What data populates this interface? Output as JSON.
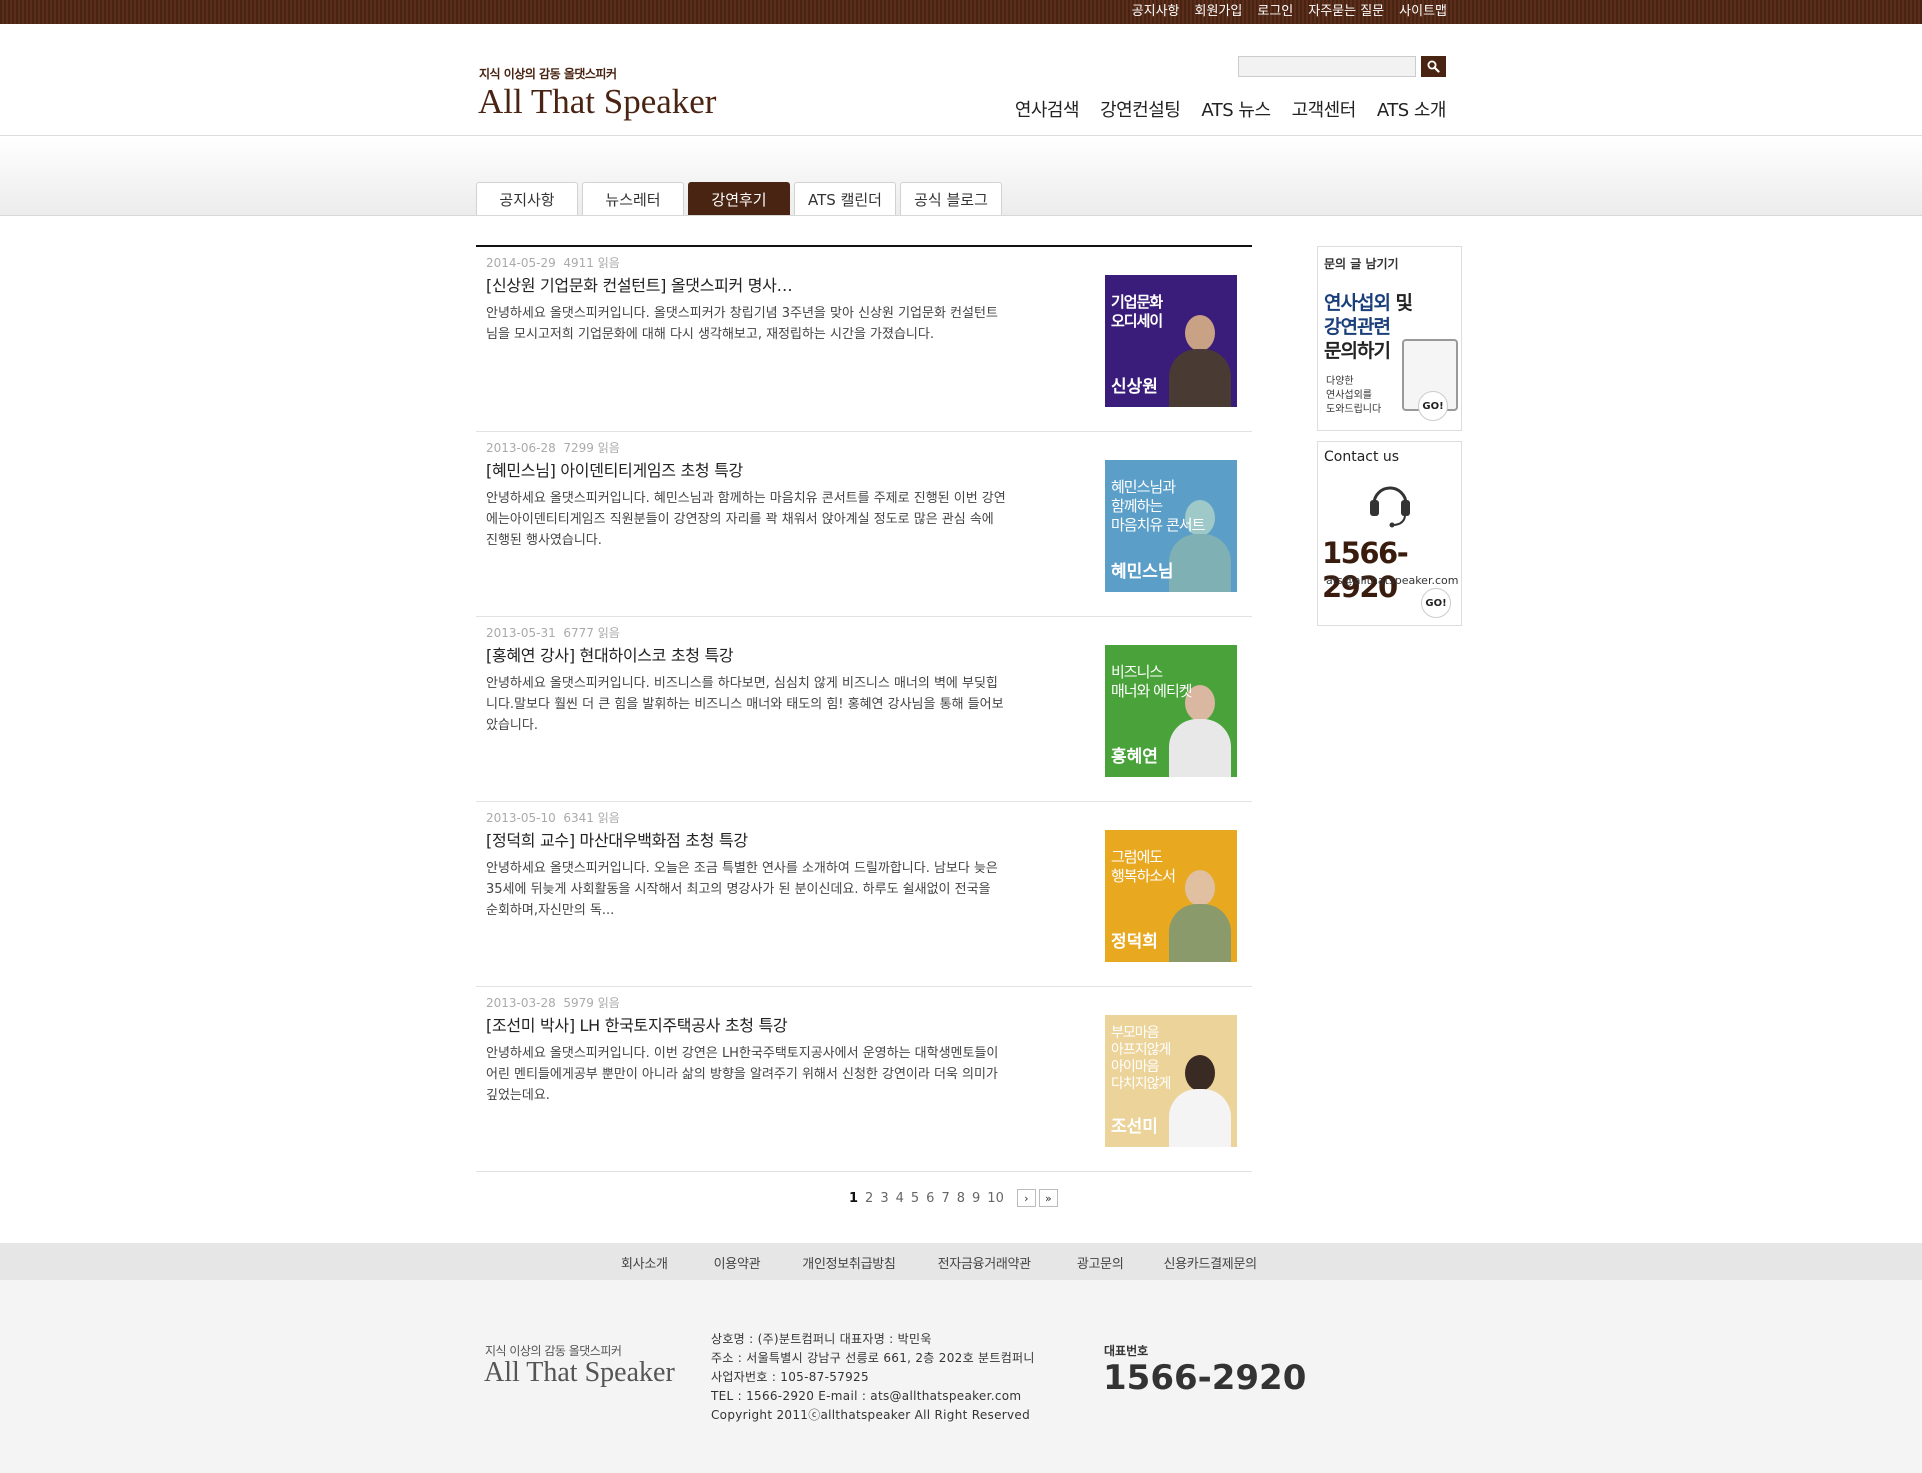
{
  "topbar": {
    "links": [
      "공지사항",
      "회원가입",
      "로그인",
      "자주묻는 질문",
      "사이트맵"
    ]
  },
  "header": {
    "tagline": "지식 이상의 감동 올댓스피커",
    "logo": "All That Speaker",
    "search": {
      "value": "",
      "placeholder": ""
    },
    "nav": [
      "연사검색",
      "강연컨설팅",
      "ATS 뉴스",
      "고객센터",
      "ATS 소개"
    ]
  },
  "tabs": [
    {
      "label": "공지사항",
      "active": false
    },
    {
      "label": "뉴스레터",
      "active": false
    },
    {
      "label": "강연후기",
      "active": true
    },
    {
      "label": "ATS 캘린더",
      "active": false
    },
    {
      "label": "공식 블로그",
      "active": false
    }
  ],
  "posts": [
    {
      "date": "2014-05-29",
      "views": "4911 읽음",
      "title": "[신상원 기업문화 컨설턴트] 올댓스피커 명사…",
      "desc": "안녕하세요 올댓스피커입니다. 올댓스피커가 창립기념 3주년을 맞아 신상원 기업문화 컨설턴트님을 모시고저희 기업문화에 대해 다시 생각해보고, 재정립하는 시간을 가졌습니다.",
      "thumb_caption": "기업문화\n오디세이",
      "thumb_name": "신상원",
      "thumb_color": "#3a1d7a"
    },
    {
      "date": "2013-06-28",
      "views": "7299 읽음",
      "title": "[혜민스님] 아이덴티티게임즈 초청 특강",
      "desc": "안녕하세요 올댓스피커입니다. 혜민스님과 함께하는 마음치유 콘서트를 주제로 진행된 이번 강연에는아이덴티티게임즈 직원분들이 강연장의 자리를 꽉 채워서 앉아계실 정도로 많은 관심 속에 진행된 행사였습니다.",
      "thumb_caption": "혜민스님과\n함께하는\n마음치유 콘서트",
      "thumb_name": "혜민스님",
      "thumb_color": "#5b9fc9"
    },
    {
      "date": "2013-05-31",
      "views": "6777 읽음",
      "title": "[홍혜연 강사] 현대하이스코 초청 특강",
      "desc": "안녕하세요 올댓스피커입니다. 비즈니스를 하다보면, 심심치 않게 비즈니스 매너의 벽에 부딪힙니다.말보다 훨씬 더 큰 힘을 발휘하는 비즈니스 매너와 태도의 힘! 홍혜연 강사님을 통해 들어보았습니다.",
      "thumb_caption": "비즈니스\n매너와 에티켓",
      "thumb_name": "홍혜연",
      "thumb_color": "#4aa33a"
    },
    {
      "date": "2013-05-10",
      "views": "6341 읽음",
      "title": "[정덕희 교수] 마산대우백화점 초청 특강",
      "desc": "안녕하세요 올댓스피커입니다. 오늘은 조금 특별한 연사를 소개하여 드릴까합니다. 남보다 늦은 35세에 뒤늦게 사회활동을 시작해서 최고의 명강사가 된 분이신데요. 하루도 쉴새없이 전국을 순회하며,자신만의 독...",
      "thumb_caption": "그럼에도\n행복하소서",
      "thumb_name": "정덕희",
      "thumb_color": "#e8a820"
    },
    {
      "date": "2013-03-28",
      "views": "5979 읽음",
      "title": "[조선미 박사] LH 한국토지주택공사 초청 특강",
      "desc": "안녕하세요 올댓스피커입니다. 이번 강연은 LH한국주택토지공사에서 운영하는 대학생멘토들이 어린 멘티들에게공부 뿐만이 아니라 삶의 방향을 알려주기 위해서 신청한 강연이라 더욱 의미가 깊었는데요.",
      "thumb_caption": "부모마음\n아프지않게\n아이마음\n다치지않게",
      "thumb_name": "조선미",
      "thumb_color": "#ecd39a"
    }
  ],
  "pager": {
    "pages": [
      "1",
      "2",
      "3",
      "4",
      "5",
      "6",
      "7",
      "8",
      "9",
      "10"
    ],
    "current": "1",
    "next": "›",
    "last": "»"
  },
  "side": {
    "inquiry_label": "문의 글 남기기",
    "inquiry_big_1": "연사섭외",
    "inquiry_big_1b": " 및",
    "inquiry_big_2": "강연관련",
    "inquiry_big_3": "문의하기",
    "inquiry_small": "다양한\n연사섭외를\n도와드립니다",
    "go": "GO!",
    "contact_label": "Contact us",
    "contact_phone": "1566-2920",
    "contact_email": "ats@allthatspeaker.com"
  },
  "footer": {
    "links": [
      "회사소개",
      "이용약관",
      "개인정보취급방침",
      "전자금융거래약관",
      "광고문의",
      "신용카드결제문의"
    ],
    "tagline": "지식 이상의 감동 올댓스피커",
    "logo": "All That Speaker",
    "info": [
      "상호명 : (주)분트컴퍼니 대표자명 : 박민욱",
      "주소 : 서울특별시 강남구 선릉로 661, 2층 202호 분트컴퍼니",
      "사업자번호 : 105-87-57925",
      "TEL : 1566-2920 E-mail : ats@allthatspeaker.com",
      "Copyright 2011ⓒallthatspeaker All Right Reserved"
    ],
    "phone_label": "대표번호",
    "phone": "1566-2920"
  }
}
